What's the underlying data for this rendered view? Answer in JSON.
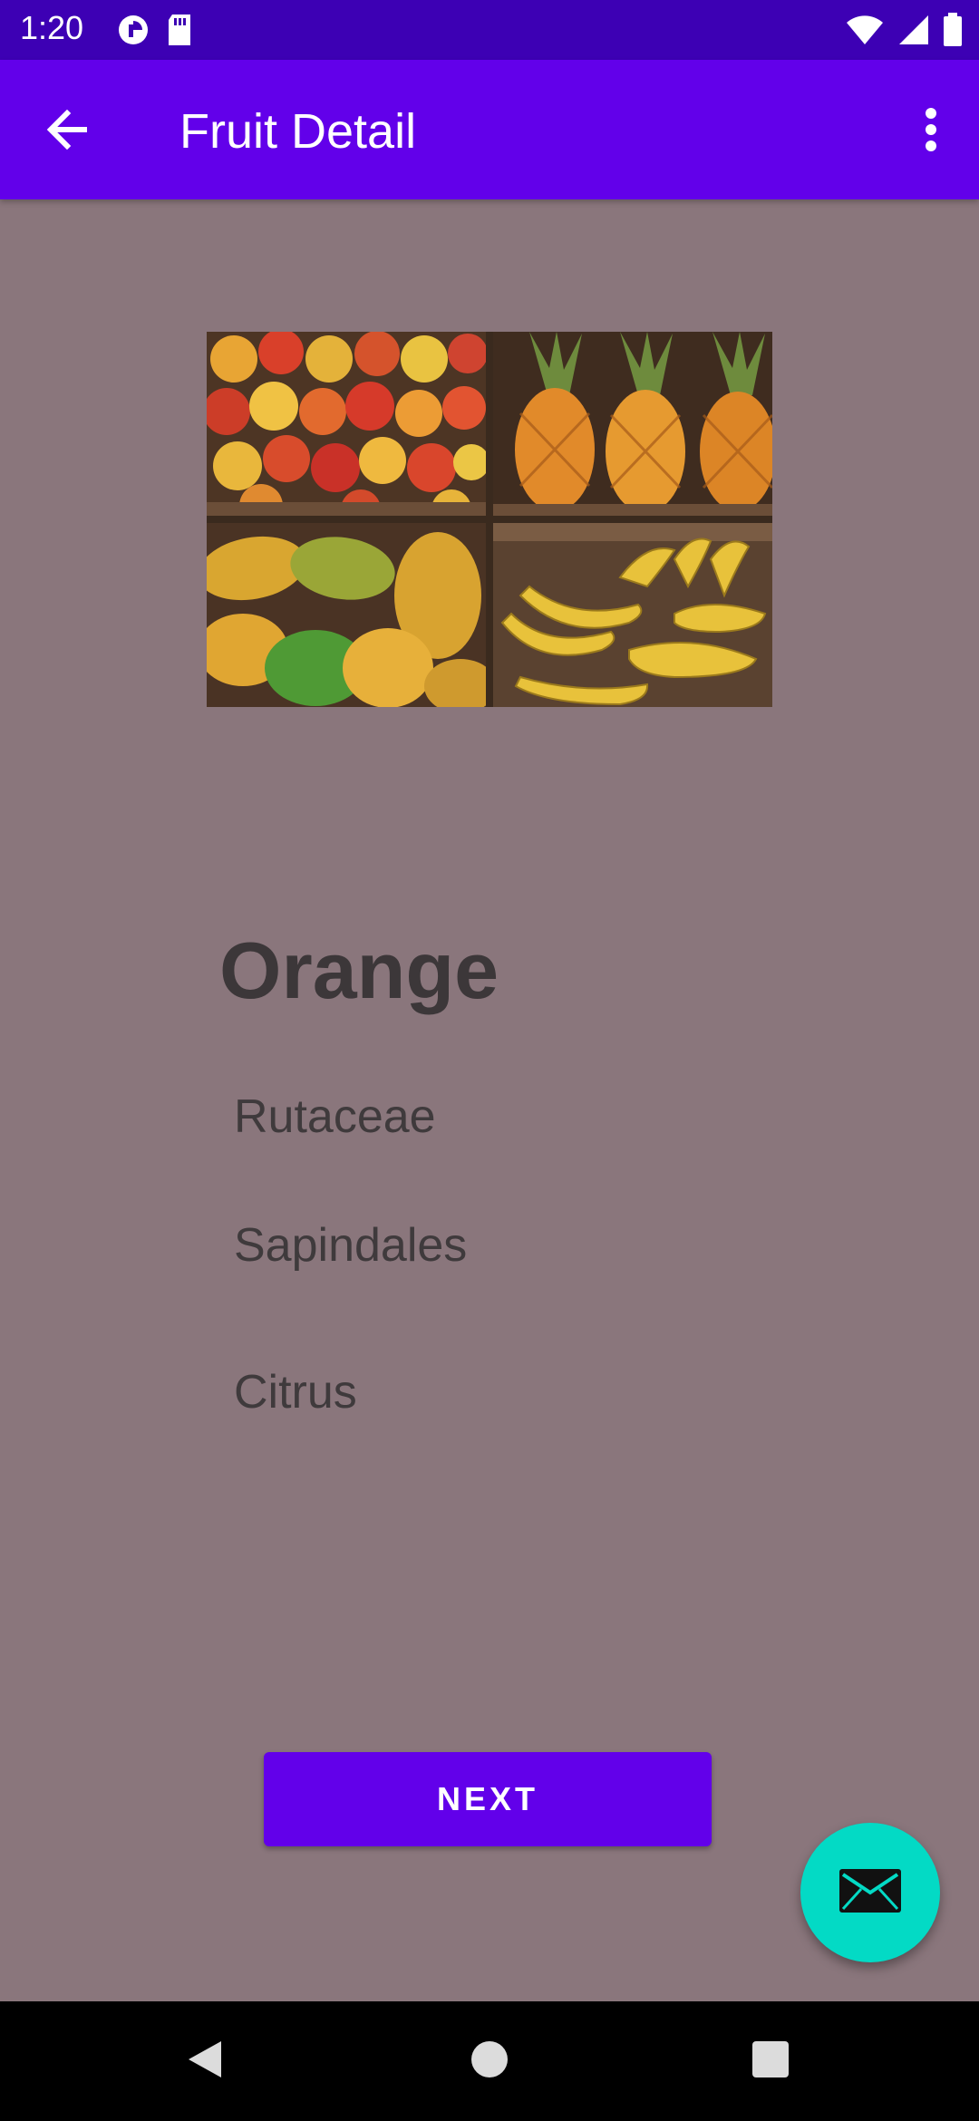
{
  "status_bar": {
    "time": "1:20",
    "icons": [
      "data-saver-icon",
      "sd-card-icon",
      "wifi-icon",
      "cellular-signal-icon",
      "battery-icon"
    ]
  },
  "app_bar": {
    "title": "Fruit Detail",
    "back_icon": "arrow-back-icon",
    "menu_icon": "more-vert-icon"
  },
  "fruit": {
    "image": "fruit-crates-image",
    "name": "Orange",
    "family": "Rutaceae",
    "order": "Sapindales",
    "genus": "Citrus"
  },
  "actions": {
    "next_label": "NEXT",
    "fab_icon": "email-icon"
  },
  "nav_bar": {
    "icons": [
      "nav-back-icon",
      "nav-home-icon",
      "nav-recents-icon"
    ]
  },
  "colors": {
    "status_bar": "#3d00b4",
    "primary": "#6200ea",
    "fab": "#03dac5",
    "background": "#8a767c"
  }
}
